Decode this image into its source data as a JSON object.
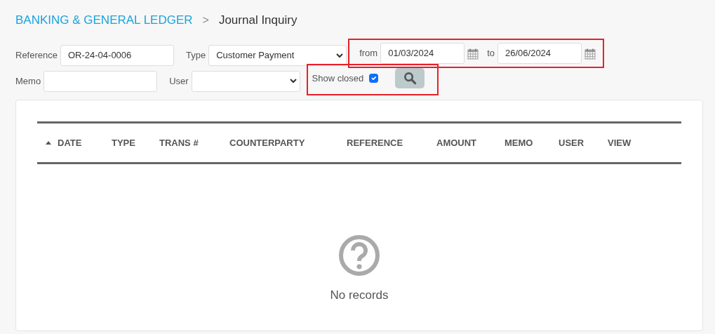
{
  "breadcrumb": {
    "section": "BANKING & GENERAL LEDGER",
    "separator": ">",
    "page": "Journal Inquiry"
  },
  "filters": {
    "reference": {
      "label": "Reference",
      "value": "OR-24-04-0006"
    },
    "type": {
      "label": "Type",
      "value": "Customer Payment"
    },
    "date_range": {
      "highlighted": true,
      "from_label": "from",
      "from": "01/03/2024",
      "to_label": "to",
      "to": "26/06/2024"
    },
    "memo": {
      "label": "Memo"
    },
    "user": {
      "label": "User"
    },
    "closed_group": {
      "highlighted": true,
      "label": "Show closed",
      "checked": true
    }
  },
  "table": {
    "columns": [
      {
        "label": "DATE",
        "sorted": true
      },
      {
        "label": "TYPE",
        "sorted": false
      },
      {
        "label": "TRANS #",
        "sorted": false
      },
      {
        "label": "COUNTERPARTY",
        "sorted": false
      },
      {
        "label": "REFERENCE",
        "sorted": false
      },
      {
        "label": "AMOUNT",
        "sorted": false
      },
      {
        "label": "MEMO",
        "sorted": false
      },
      {
        "label": "USER",
        "sorted": false
      },
      {
        "label": "VIEW",
        "sorted": false
      }
    ],
    "empty_message": "No records"
  }
}
